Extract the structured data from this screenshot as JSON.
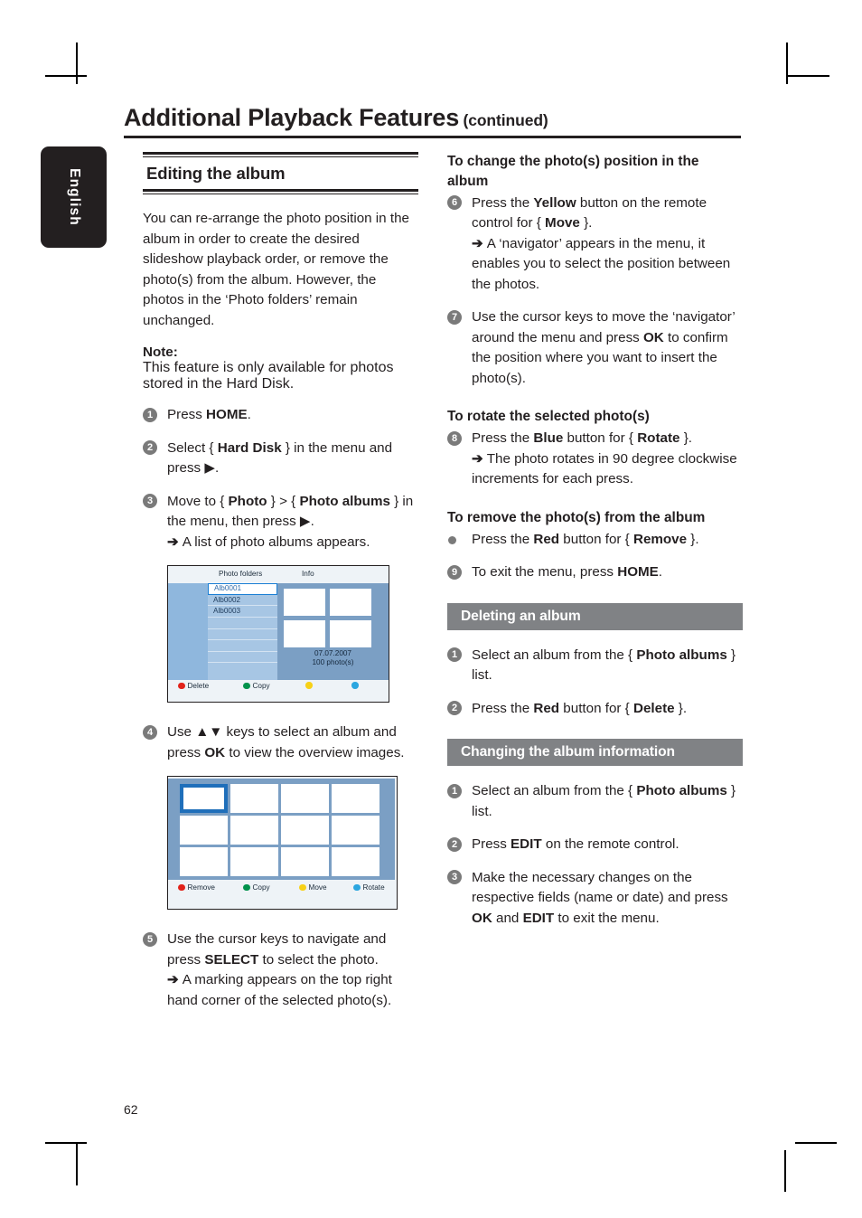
{
  "page": {
    "language_tab": "English",
    "number": "62",
    "header": {
      "title": "Additional Playback Features",
      "continued": "(continued)"
    }
  },
  "left_column": {
    "section_title": "Editing the album",
    "intro": "You can re-arrange the photo position in the album in order to create the desired slideshow playback order, or remove the photo(s) from the album. However, the photos in the ‘Photo folders’ remain unchanged.",
    "note_label": "Note:",
    "note_text": "This feature is only available for photos stored in the Hard Disk.",
    "steps": [
      {
        "num": "1",
        "parts": [
          {
            "t": "Press ",
            "b": false
          },
          {
            "t": "HOME",
            "b": true
          },
          {
            "t": ".",
            "b": false
          }
        ]
      },
      {
        "num": "2",
        "parts": [
          {
            "t": "Select { ",
            "b": false
          },
          {
            "t": "Hard Disk",
            "b": true
          },
          {
            "t": " } in the menu and press ▶.",
            "b": false
          }
        ]
      },
      {
        "num": "3",
        "parts": [
          {
            "t": "Move to { ",
            "b": false
          },
          {
            "t": "Photo",
            "b": true
          },
          {
            "t": " } > { ",
            "b": false
          },
          {
            "t": "Photo albums",
            "b": true
          },
          {
            "t": " } in the menu, then press ▶.",
            "b": false
          }
        ],
        "arrow": "A list of photo albums appears."
      },
      {
        "num": "4",
        "parts": [
          {
            "t": "Use ▲▼ keys to select an album and press ",
            "b": false
          },
          {
            "t": "OK",
            "b": true
          },
          {
            "t": " to view the overview images.",
            "b": false
          }
        ]
      },
      {
        "num": "5",
        "parts": [
          {
            "t": "Use the cursor keys to navigate and press ",
            "b": false
          },
          {
            "t": "SELECT",
            "b": true
          },
          {
            "t": " to select the photo.",
            "b": false
          }
        ],
        "arrow": "A marking appears on the top right hand corner of the selected photo(s)."
      }
    ],
    "figure_folders": {
      "header_folders": "Photo folders",
      "header_info": "Info",
      "albums": [
        "Alb0001",
        "Alb0002",
        "Alb0003"
      ],
      "empty_rows": 4,
      "info_date": "07.07.2007",
      "info_count": "100 photo(s)",
      "buttons": [
        {
          "label": "Delete",
          "color": "#e2231a"
        },
        {
          "label": "Copy",
          "color": "#00924c"
        },
        {
          "label": "",
          "color": "#f7d117"
        },
        {
          "label": "",
          "color": "#2ba6e0"
        }
      ]
    },
    "figure_grid": {
      "cells": 12,
      "selected_index": 0,
      "buttons": [
        {
          "label": "Remove",
          "color": "#e2231a"
        },
        {
          "label": "Copy",
          "color": "#00924c"
        },
        {
          "label": "Move",
          "color": "#f7d117"
        },
        {
          "label": "Rotate",
          "color": "#2ba6e0"
        }
      ]
    }
  },
  "right_column": {
    "heading_position": "To change the photo(s) position in the album",
    "heading_rotate": "To rotate the selected photo(s)",
    "heading_remove": "To remove the photo(s) from the album",
    "steps": [
      {
        "num": "6",
        "parts": [
          {
            "t": "Press the ",
            "b": false
          },
          {
            "t": "Yellow",
            "b": true
          },
          {
            "t": " button on the remote control for { ",
            "b": false
          },
          {
            "t": "Move",
            "b": true
          },
          {
            "t": " }.",
            "b": false
          }
        ],
        "arrow": "A ‘navigator’ appears in the menu, it enables you to select the position between the photos."
      },
      {
        "num": "7",
        "parts": [
          {
            "t": "Use the cursor keys to move the ‘navigator’ around the menu and press ",
            "b": false
          },
          {
            "t": "OK",
            "b": true
          },
          {
            "t": " to confirm the position where you want to insert the photo(s).",
            "b": false
          }
        ]
      },
      {
        "num": "8",
        "parts": [
          {
            "t": "Press the ",
            "b": false
          },
          {
            "t": "Blue",
            "b": true
          },
          {
            "t": " button for { ",
            "b": false
          },
          {
            "t": "Rotate",
            "b": true
          },
          {
            "t": " }.",
            "b": false
          }
        ],
        "arrow": "The photo rotates in 90 degree clockwise increments for each press."
      },
      {
        "num": "•",
        "bullet": true,
        "parts": [
          {
            "t": "Press the ",
            "b": false
          },
          {
            "t": "Red",
            "b": true
          },
          {
            "t": " button for { ",
            "b": false
          },
          {
            "t": "Remove",
            "b": true
          },
          {
            "t": " }.",
            "b": false
          }
        ]
      },
      {
        "num": "9",
        "parts": [
          {
            "t": "To exit the menu, press ",
            "b": false
          },
          {
            "t": "HOME",
            "b": true
          },
          {
            "t": ".",
            "b": false
          }
        ]
      }
    ],
    "banner_delete": "Deleting an album",
    "delete_steps": [
      {
        "num": "1",
        "parts": [
          {
            "t": "Select an album from the { ",
            "b": false
          },
          {
            "t": "Photo albums",
            "b": true
          },
          {
            "t": " } list.",
            "b": false
          }
        ]
      },
      {
        "num": "2",
        "parts": [
          {
            "t": "Press the ",
            "b": false
          },
          {
            "t": "Red",
            "b": true
          },
          {
            "t": " button for { ",
            "b": false
          },
          {
            "t": "Delete",
            "b": true
          },
          {
            "t": " }.",
            "b": false
          }
        ]
      }
    ],
    "banner_change": "Changing the album information",
    "change_steps": [
      {
        "num": "1",
        "parts": [
          {
            "t": "Select an album from the { ",
            "b": false
          },
          {
            "t": "Photo albums",
            "b": true
          },
          {
            "t": " } list.",
            "b": false
          }
        ]
      },
      {
        "num": "2",
        "parts": [
          {
            "t": "Press ",
            "b": false
          },
          {
            "t": "EDIT",
            "b": true
          },
          {
            "t": " on the remote control.",
            "b": false
          }
        ]
      },
      {
        "num": "3",
        "parts": [
          {
            "t": "Make the necessary changes on the respective fields (name or date) and press ",
            "b": false
          },
          {
            "t": "OK",
            "b": true
          },
          {
            "t": " and ",
            "b": false
          },
          {
            "t": "EDIT",
            "b": true
          },
          {
            "t": " to exit the menu.",
            "b": false
          }
        ]
      }
    ]
  },
  "colors": {
    "banner_grey": "#808285",
    "step_circle_grey": "#7a7a7a",
    "tab_black": "#231f20"
  }
}
